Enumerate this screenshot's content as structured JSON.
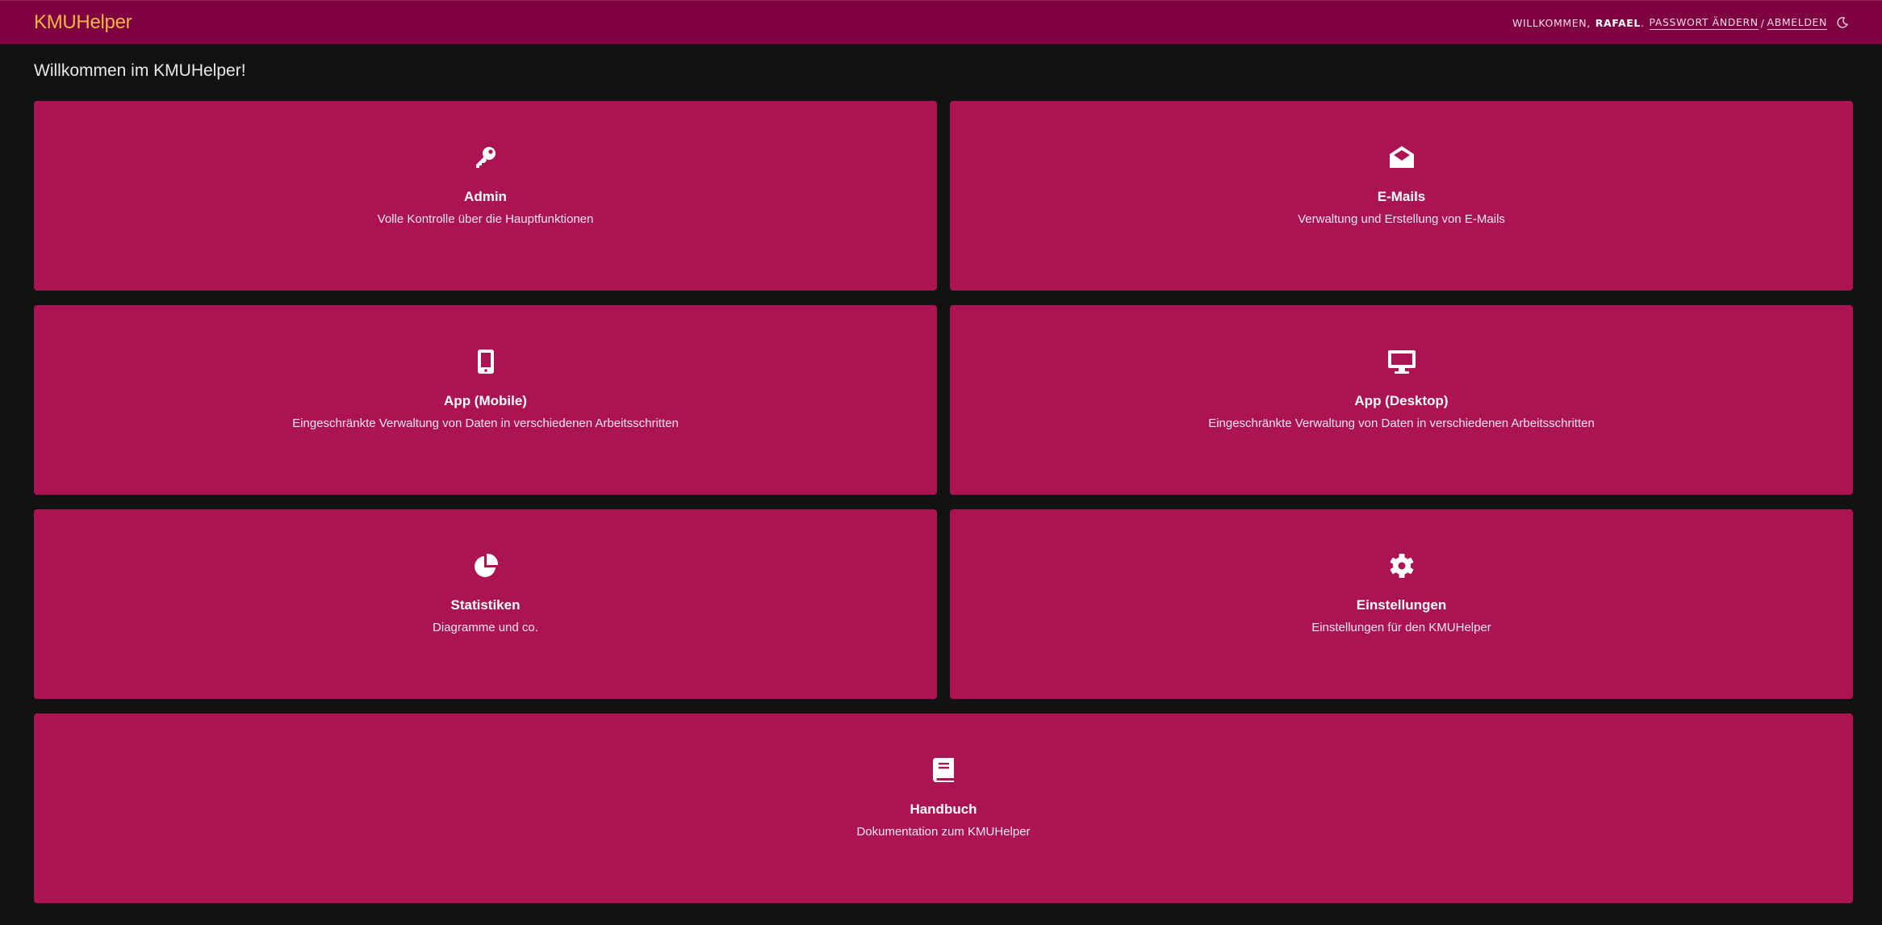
{
  "header": {
    "brand": "KMUHelper",
    "welcome_prefix": "WILLKOMMEN,",
    "username": "RAFAEL",
    "after_username": ".",
    "change_password": "PASSWORT ÄNDERN",
    "separator": "/",
    "logout": "ABMELDEN",
    "theme_icon": "moon-icon"
  },
  "main": {
    "welcome": "Willkommen im KMUHelper!",
    "tiles": [
      {
        "title": "Admin",
        "description": "Volle Kontrolle über die Hauptfunktionen",
        "icon": "key-icon"
      },
      {
        "title": "E-Mails",
        "description": "Verwaltung und Erstellung von E-Mails",
        "icon": "envelope-open-icon"
      },
      {
        "title": "App (Mobile)",
        "description": "Eingeschränkte Verwaltung von Daten in verschiedenen Arbeitsschritten",
        "icon": "mobile-icon"
      },
      {
        "title": "App (Desktop)",
        "description": "Eingeschränkte Verwaltung von Daten in verschiedenen Arbeitsschritten",
        "icon": "desktop-icon"
      },
      {
        "title": "Statistiken",
        "description": "Diagramme und co.",
        "icon": "pie-chart-icon"
      },
      {
        "title": "Einstellungen",
        "description": "Einstellungen für den KMUHelper",
        "icon": "gear-icon"
      },
      {
        "title": "Handbuch",
        "description": "Dokumentation zum KMUHelper",
        "icon": "book-icon"
      }
    ]
  },
  "colors": {
    "header_bg": "#7f0040",
    "brand": "#f5b544",
    "tile_bg": "#ab1353",
    "page_bg": "#121212"
  }
}
